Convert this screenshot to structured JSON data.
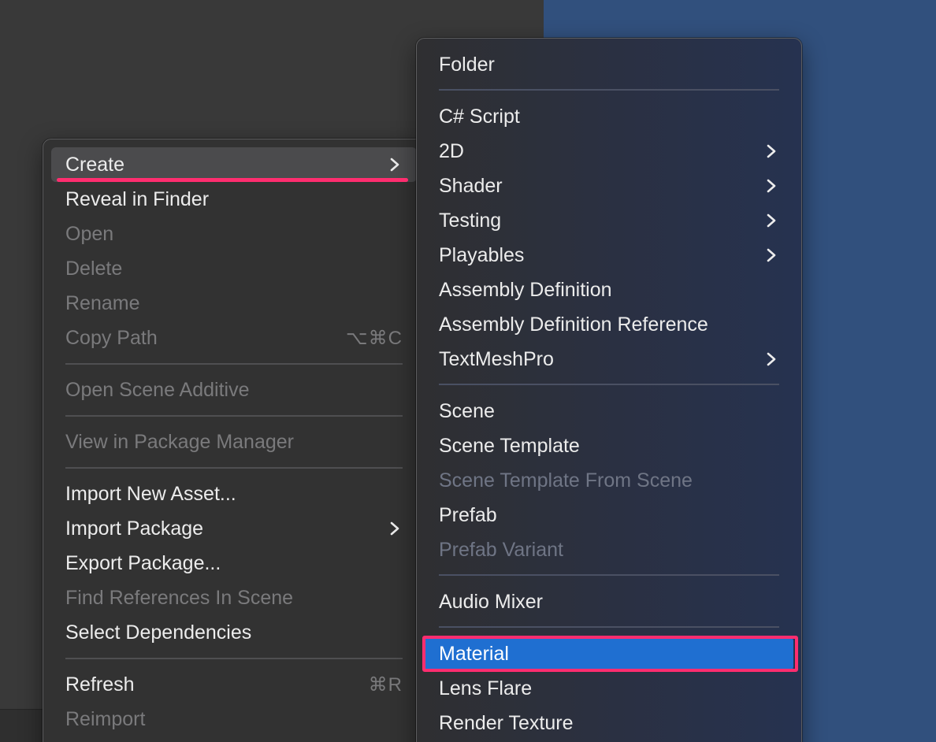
{
  "main_menu": {
    "items": [
      {
        "label": "Create",
        "enabled": true,
        "submenu": true,
        "state": "hovered"
      },
      {
        "label": "Reveal in Finder",
        "enabled": true
      },
      {
        "label": "Open",
        "enabled": false
      },
      {
        "label": "Delete",
        "enabled": false
      },
      {
        "label": "Rename",
        "enabled": false
      },
      {
        "label": "Copy Path",
        "enabled": false,
        "shortcut": "⌥⌘C"
      },
      {
        "label": "Open Scene Additive",
        "enabled": false
      },
      {
        "label": "View in Package Manager",
        "enabled": false
      },
      {
        "label": "Import New Asset...",
        "enabled": true
      },
      {
        "label": "Import Package",
        "enabled": true,
        "submenu": true
      },
      {
        "label": "Export Package...",
        "enabled": true
      },
      {
        "label": "Find References In Scene",
        "enabled": false
      },
      {
        "label": "Select Dependencies",
        "enabled": true
      },
      {
        "label": "Refresh",
        "enabled": true,
        "shortcut": "⌘R"
      },
      {
        "label": "Reimport",
        "enabled": false
      }
    ]
  },
  "sub_menu": {
    "items": [
      {
        "label": "Folder",
        "enabled": true
      },
      {
        "label": "C# Script",
        "enabled": true
      },
      {
        "label": "2D",
        "enabled": true,
        "submenu": true
      },
      {
        "label": "Shader",
        "enabled": true,
        "submenu": true
      },
      {
        "label": "Testing",
        "enabled": true,
        "submenu": true
      },
      {
        "label": "Playables",
        "enabled": true,
        "submenu": true
      },
      {
        "label": "Assembly Definition",
        "enabled": true
      },
      {
        "label": "Assembly Definition Reference",
        "enabled": true
      },
      {
        "label": "TextMeshPro",
        "enabled": true,
        "submenu": true
      },
      {
        "label": "Scene",
        "enabled": true
      },
      {
        "label": "Scene Template",
        "enabled": true
      },
      {
        "label": "Scene Template From Scene",
        "enabled": false
      },
      {
        "label": "Prefab",
        "enabled": true
      },
      {
        "label": "Prefab Variant",
        "enabled": false
      },
      {
        "label": "Audio Mixer",
        "enabled": true
      },
      {
        "label": "Material",
        "enabled": true,
        "state": "selected"
      },
      {
        "label": "Lens Flare",
        "enabled": true
      },
      {
        "label": "Render Texture",
        "enabled": true
      }
    ]
  },
  "colors": {
    "highlight_annotation": "#ff2d6f",
    "selection": "#1f6fd1",
    "scene_background": "#31507d"
  }
}
